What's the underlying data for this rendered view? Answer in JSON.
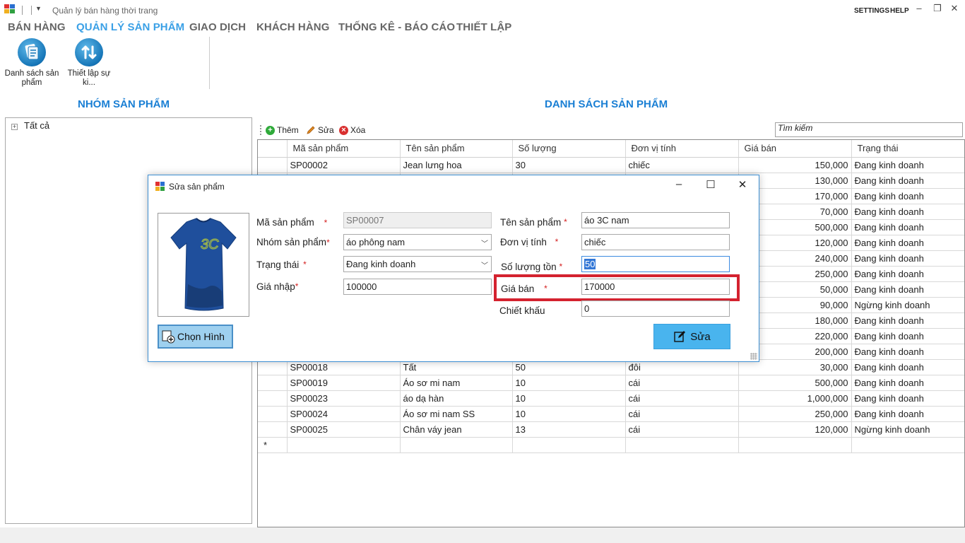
{
  "window": {
    "title": "Quản lý bán hàng thời trang",
    "settings_label": "SETTINGS",
    "help_label": "HELP"
  },
  "menu": [
    {
      "label": "BÁN HÀNG",
      "active": false
    },
    {
      "label": "QUẢN LÝ SẢN PHẨM",
      "active": true
    },
    {
      "label": "GIAO DỊCH",
      "active": false
    },
    {
      "label": "KHÁCH HÀNG",
      "active": false
    },
    {
      "label": "THỐNG KÊ - BÁO CÁO",
      "active": false
    },
    {
      "label": "THIẾT LẬP",
      "active": false
    }
  ],
  "ribbon": [
    {
      "label": "Danh sách sản phẩm",
      "icon": "product-list-icon"
    },
    {
      "label": "Thiết lập sự ki...",
      "icon": "event-settings-icon"
    }
  ],
  "group_panel": {
    "title": "NHÓM SẢN PHẨM",
    "tree_root": "Tất cả"
  },
  "product_panel": {
    "title": "DANH SÁCH SẢN PHẨM",
    "toolbar": {
      "add_label": "Thêm",
      "edit_label": "Sửa",
      "delete_label": "Xóa"
    },
    "search_value": "Tìm kiếm"
  },
  "grid": {
    "columns": [
      "Mã sản phẩm",
      "Tên sản phẩm",
      "Số lượng",
      "Đơn vị tính",
      "Giá bán",
      "Trạng thái"
    ],
    "rows": [
      [
        "SP00002",
        "Jean lưng hoa",
        "30",
        "chiếc",
        "150,000",
        "Đang kinh doanh"
      ],
      [
        "",
        "",
        "",
        "",
        "130,000",
        "Đang kinh doanh"
      ],
      [
        "",
        "",
        "",
        "",
        "170,000",
        "Đang kinh doanh"
      ],
      [
        "",
        "",
        "",
        "",
        "70,000",
        "Đang kinh doanh"
      ],
      [
        "",
        "",
        "",
        "",
        "500,000",
        "Đang kinh doanh"
      ],
      [
        "",
        "",
        "",
        "",
        "120,000",
        "Đang kinh doanh"
      ],
      [
        "",
        "",
        "",
        "",
        "240,000",
        "Đang kinh doanh"
      ],
      [
        "",
        "",
        "",
        "",
        "250,000",
        "Đang kinh doanh"
      ],
      [
        "",
        "",
        "",
        "",
        "50,000",
        "Đang kinh doanh"
      ],
      [
        "",
        "",
        "",
        "",
        "90,000",
        "Ngừng kinh doanh"
      ],
      [
        "",
        "",
        "",
        "",
        "180,000",
        "Đang kinh doanh"
      ],
      [
        "",
        "",
        "",
        "",
        "220,000",
        "Đang kinh doanh"
      ],
      [
        "",
        "",
        "",
        "",
        "200,000",
        "Đang kinh doanh"
      ],
      [
        "SP00018",
        "Tất",
        "50",
        "đôi",
        "30,000",
        "Đang kinh doanh"
      ],
      [
        "SP00019",
        "Áo sơ mi nam",
        "10",
        "cái",
        "500,000",
        "Đang kinh doanh"
      ],
      [
        "SP00023",
        "áo dạ hàn",
        "10",
        "cái",
        "1,000,000",
        "Đang kinh doanh"
      ],
      [
        "SP00024",
        "Áo sơ mi nam SS",
        "10",
        "cái",
        "250,000",
        "Đang kinh doanh"
      ],
      [
        "SP00025",
        "Chân váy jean",
        "13",
        "cái",
        "120,000",
        "Ngừng kinh doanh"
      ]
    ],
    "new_row_marker": "*"
  },
  "dialog": {
    "title": "Sửa sản phẩm",
    "choose_image_label": "Chọn Hình",
    "save_label": "Sửa",
    "fields": {
      "product_code": {
        "label": "Mã sản phẩm",
        "value": "SP00007"
      },
      "product_group": {
        "label": "Nhóm sản phẩm",
        "value": "áo phông nam"
      },
      "status": {
        "label": "Trạng thái",
        "value": "Đang kinh doanh"
      },
      "import_price": {
        "label": "Giá nhập",
        "value": "100000"
      },
      "product_name": {
        "label": "Tên sản phẩm",
        "value": "áo 3C nam"
      },
      "unit": {
        "label": "Đơn vị tính",
        "value": "chiếc"
      },
      "stock": {
        "label": "Số lượng tồn",
        "value": "50"
      },
      "sale_price": {
        "label": "Giá bán",
        "value": "170000"
      },
      "discount": {
        "label": "Chiết khấu",
        "value": "0"
      }
    },
    "required_mark": "*"
  },
  "colors": {
    "accent": "#3aa0e6",
    "section_title": "#1a7fd4",
    "highlight": "#d4222f",
    "save_button": "#49b4ee"
  }
}
